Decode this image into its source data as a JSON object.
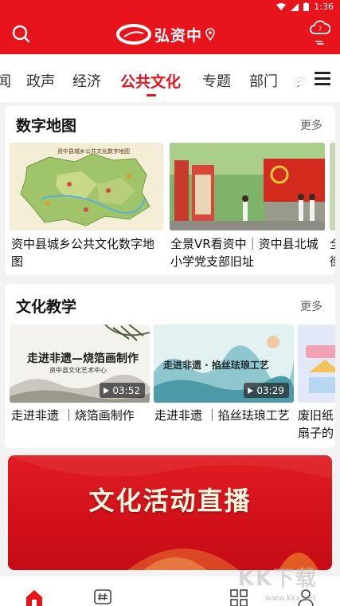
{
  "status_bar": {
    "time": "1:36"
  },
  "header": {
    "logo_text": "弘资中"
  },
  "tabs": {
    "items": [
      {
        "label": "闻"
      },
      {
        "label": "政声"
      },
      {
        "label": "经济"
      },
      {
        "label": "公共文化"
      },
      {
        "label": "专题"
      },
      {
        "label": "部门"
      },
      {
        "label": "乡"
      }
    ],
    "active_index": 3
  },
  "digital_map": {
    "title": "数字地图",
    "more_label": "更多",
    "items": [
      {
        "caption": "资中县城乡公共文化数字地图",
        "thumb_text": "资中县城乡公共文化数字地图"
      },
      {
        "caption": "全景VR看资中｜资中县北城小学党支部旧址"
      },
      {
        "caption": "全街"
      }
    ]
  },
  "culture_teaching": {
    "title": "文化教学",
    "more_label": "更多",
    "items": [
      {
        "caption": "走进非遗 ｜烧箔画制作",
        "duration": "03:52",
        "thumb_title": "走进非遗—烧箔画制作",
        "thumb_sub": "资中县文化艺术中心"
      },
      {
        "caption": "走进非遗 ｜掐丝珐琅工艺",
        "duration": "03:29",
        "thumb_title": "走进非遗 · 掐丝珐琅工艺"
      },
      {
        "caption": "废旧纸扇子的"
      }
    ]
  },
  "banner": {
    "text": "文化活动直播"
  },
  "watermark": {
    "text": "KK下载",
    "url": "www.kkx.net"
  },
  "colors": {
    "brand_red": "#e8141b"
  }
}
